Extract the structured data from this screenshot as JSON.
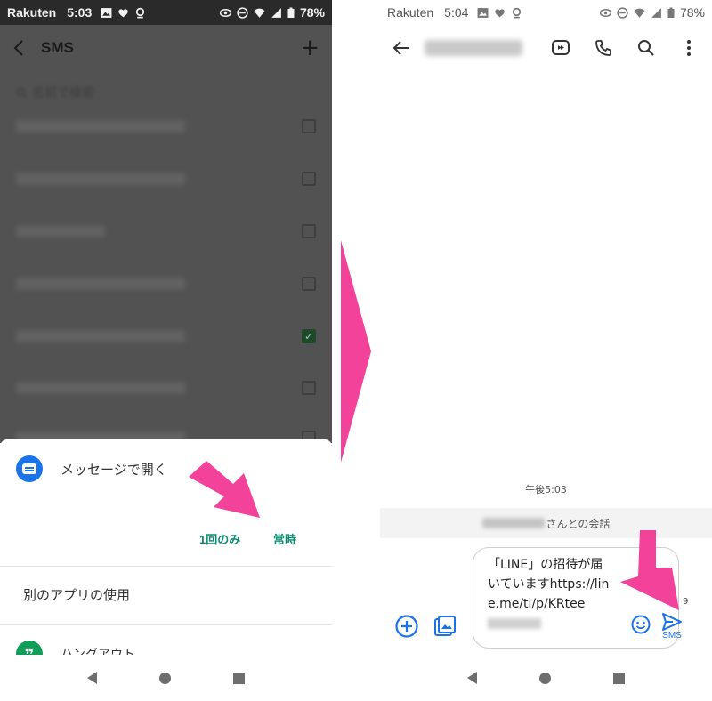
{
  "left_screen": {
    "status_bar": {
      "carrier": "Rakuten",
      "time": "5:03",
      "battery": "78%"
    },
    "dim_app": {
      "title": "SMS",
      "search_placeholder": "名前で検索"
    },
    "chooser": {
      "open_with_label": "メッセージで開く",
      "just_once_label": "1回のみ",
      "always_label": "常時",
      "use_other_app_label": "別のアプリの使用",
      "hangouts_label": "ハングアウト"
    }
  },
  "right_screen": {
    "status_bar": {
      "carrier": "Rakuten",
      "time": "5:04",
      "battery": "78%"
    },
    "conversation": {
      "timestamp": "午後5:03",
      "notice_suffix": "さんとの会話",
      "message_draft": "「LINE」の招待が届いていますhttps://line.me/ti/p/KRtee",
      "char_count": "9",
      "send_label": "SMS"
    }
  },
  "colors": {
    "accent_pink": "#f2429a",
    "teal_button": "#0b8a6e",
    "blue": "#1a73e8",
    "hangouts_green": "#0f9d58"
  },
  "icons": {
    "messages_app": "message-bubble-icon",
    "hangouts_app": "hangouts-quote-icon",
    "send": "send-icon"
  }
}
